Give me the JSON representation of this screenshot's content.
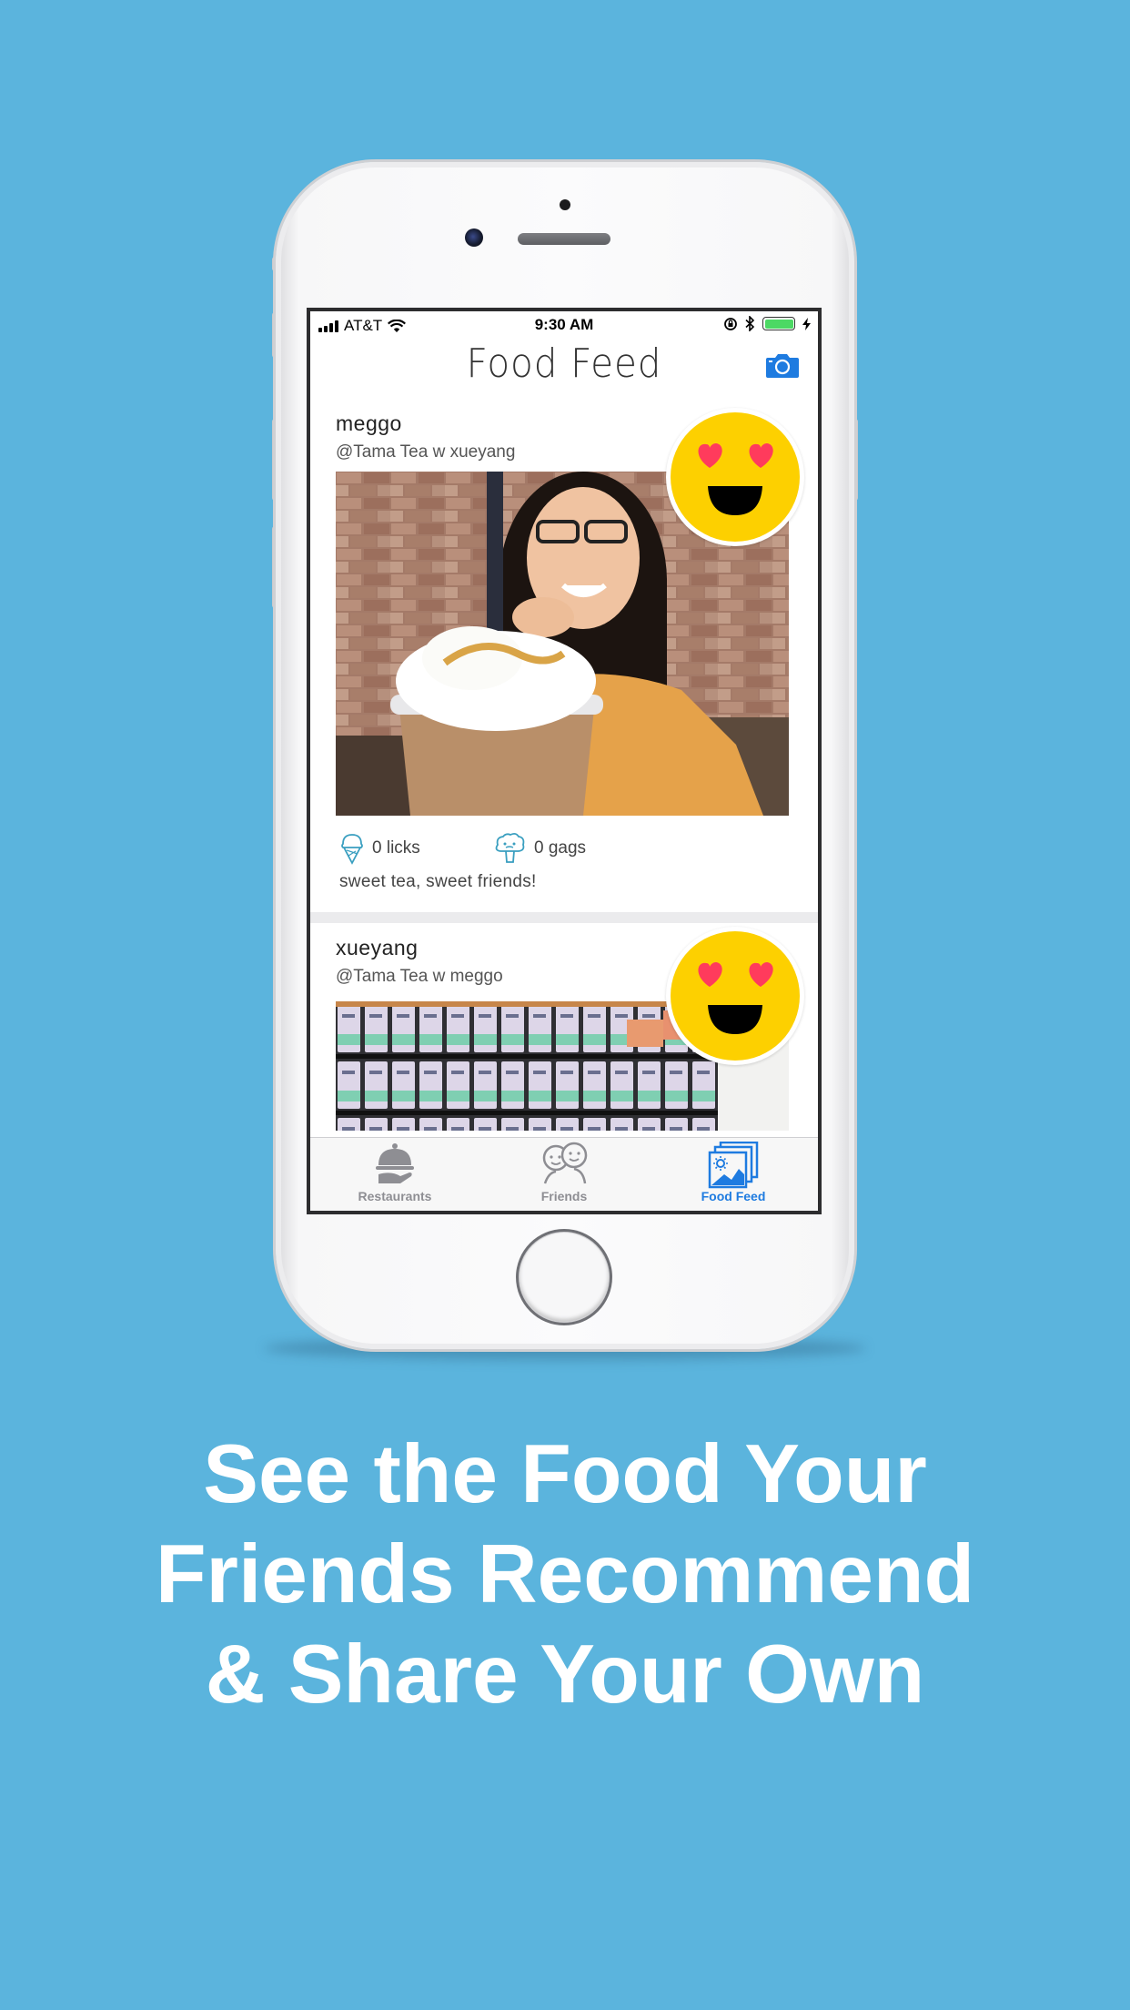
{
  "colors": {
    "background": "#5bb4dd",
    "accent": "#1e7be0",
    "emoji_yellow": "#fdd000",
    "heart_red": "#ff3b5c",
    "battery_green": "#4cd964"
  },
  "status_bar": {
    "carrier": "AT&T",
    "time": "9:30 AM"
  },
  "nav": {
    "title": "Food Feed",
    "camera_icon": "camera-icon"
  },
  "feed": {
    "posts": [
      {
        "user": "meggo",
        "place": "@Tama Tea w xueyang",
        "rating_icon": "heart-eyes-emoji-icon",
        "licks": "0 licks",
        "gags": "0 gags",
        "caption": "sweet tea, sweet friends!"
      },
      {
        "user": "xueyang",
        "place": "@Tama Tea w meggo",
        "rating_icon": "heart-eyes-emoji-icon"
      }
    ]
  },
  "tabs": [
    {
      "label": "Restaurants",
      "icon": "cloche-icon"
    },
    {
      "label": "Friends",
      "icon": "friends-icon"
    },
    {
      "label": "Food Feed",
      "icon": "photo-stack-icon",
      "active": true
    }
  ],
  "headline": {
    "line1": "See the Food Your",
    "line2": "Friends Recommend",
    "line3": "& Share Your Own"
  }
}
